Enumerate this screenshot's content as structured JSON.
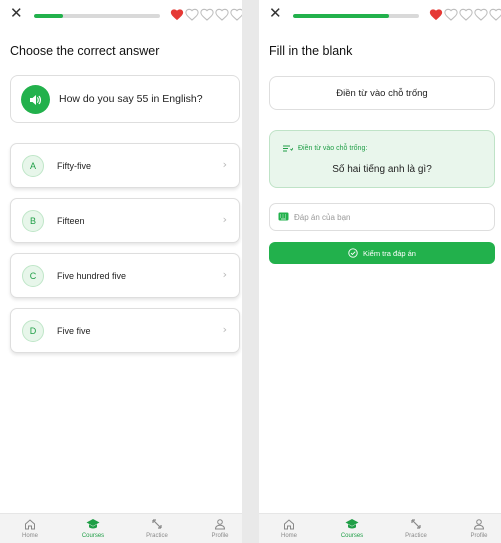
{
  "colors": {
    "accent": "#22b14c",
    "heart_filled": "#e53935",
    "heart_empty": "#bdbdbd",
    "track": "#d9d9d9",
    "hint_bg": "#e9f6ec"
  },
  "icons": {
    "close": "close-icon",
    "audio": "speaker-icon",
    "heart": "heart-icon",
    "chevron": "chevron-right-icon",
    "hint": "text-lines-icon",
    "keyboard": "keyboard-icon",
    "check": "check-circle-icon"
  },
  "left_screen": {
    "close_glyph": "✕",
    "progress": 0.23,
    "lives": {
      "filled": 1,
      "total": 5
    },
    "title": "Choose the correct answer",
    "question": "How do you say 55 in English?",
    "options": [
      {
        "letter": "A",
        "label": "Fifty-five"
      },
      {
        "letter": "B",
        "label": "Fifteen"
      },
      {
        "letter": "C",
        "label": "Five hundred five"
      },
      {
        "letter": "D",
        "label": "Five five"
      }
    ],
    "chevron_glyph": "›"
  },
  "right_screen": {
    "close_glyph": "✕",
    "progress": 0.76,
    "lives": {
      "filled": 1,
      "total": 5
    },
    "title": "Fill in the blank",
    "prompt": "Điền từ vào chỗ trống",
    "hint_label": "Điền từ vào chỗ trống:",
    "hint_question": "Số hai tiếng anh là gì?",
    "answer_placeholder": "Đáp án của bạn",
    "answer_value": "",
    "check_button": "Kiểm tra đáp án"
  },
  "bottom_nav": {
    "items": [
      {
        "label": "Home",
        "icon": "home-icon",
        "active": false
      },
      {
        "label": "Courses",
        "icon": "graduation-cap-icon",
        "active": true
      },
      {
        "label": "Practice",
        "icon": "practice-arrows-icon",
        "active": false
      },
      {
        "label": "Profile",
        "icon": "profile-icon",
        "active": false
      }
    ]
  }
}
